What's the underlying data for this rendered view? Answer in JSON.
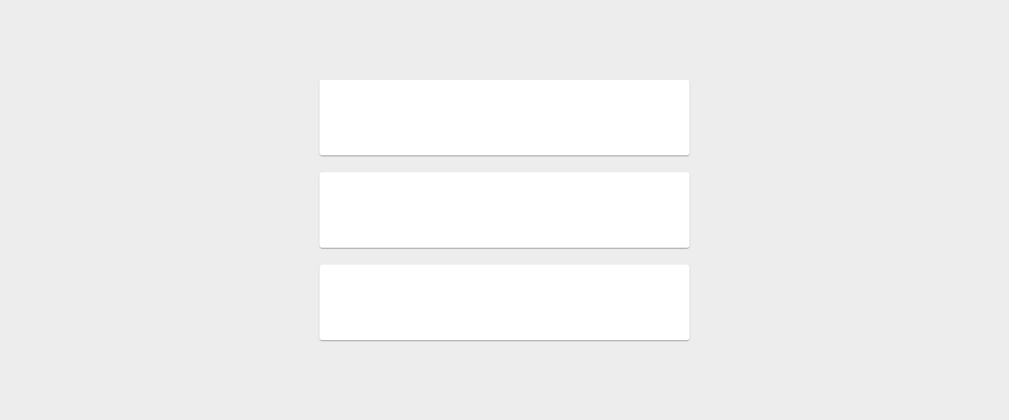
{
  "colors": {
    "background": "#ededed",
    "cardBackground": "#ffffff"
  },
  "layout": {
    "cardCount": 3
  },
  "cards": [
    {
      "content": ""
    },
    {
      "content": ""
    },
    {
      "content": ""
    }
  ]
}
